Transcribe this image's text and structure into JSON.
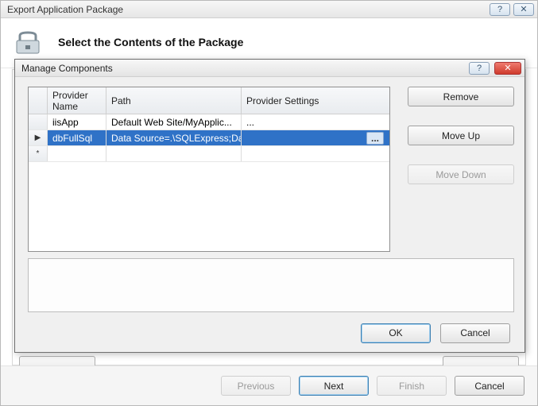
{
  "outer": {
    "title": "Export Application Package",
    "wizard_title": "Select the Contents of the Package",
    "buttons": {
      "previous": "Previous",
      "next": "Next",
      "finish": "Finish",
      "cancel": "Cancel"
    }
  },
  "dialog": {
    "title": "Manage Components",
    "columns": {
      "provider": "Provider Name",
      "path": "Path",
      "settings": "Provider Settings"
    },
    "rows": [
      {
        "marker": "",
        "provider": "iisApp",
        "path": "Default Web Site/MyApplic...",
        "settings": "..."
      },
      {
        "marker": "▶",
        "provider": "dbFullSql",
        "path": "Data Source=.\\SQLExpress;Dat",
        "settings": "..."
      },
      {
        "marker": "*",
        "provider": "",
        "path": "",
        "settings": ""
      }
    ],
    "selected_index": 1,
    "side": {
      "remove": "Remove",
      "moveup": "Move Up",
      "movedown": "Move Down"
    },
    "footer": {
      "ok": "OK",
      "cancel": "Cancel"
    }
  }
}
